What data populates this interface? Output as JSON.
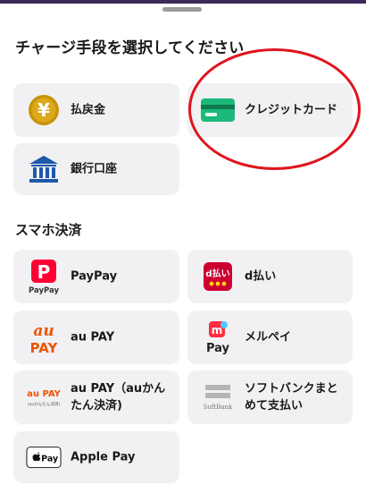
{
  "sheet": {
    "title": "チャージ手段を選択してください"
  },
  "main_methods": [
    {
      "label": "払戻金",
      "icon": "yen-coin-icon"
    },
    {
      "label": "クレジットカード",
      "icon": "credit-card-icon"
    },
    {
      "label": "銀行口座",
      "icon": "bank-icon"
    }
  ],
  "smartphone_section": {
    "title": "スマホ決済",
    "items": [
      {
        "label": "PayPay",
        "icon": "paypay-icon",
        "icon_text": "PayPay"
      },
      {
        "label": "d払い",
        "icon": "d-barai-icon",
        "icon_text": "d払い"
      },
      {
        "label": "au PAY",
        "icon": "au-pay-icon",
        "icon_text_top": "au",
        "icon_text_bottom": "PAY"
      },
      {
        "label": "メルペイ",
        "icon": "merpay-icon",
        "icon_text": "Pay"
      },
      {
        "label": "au PAY（auかんたん決済)",
        "icon": "au-pay-kantan-icon",
        "icon_text_top": "au PAY",
        "icon_text_bottom": "(auかんたん決済)"
      },
      {
        "label": "ソフトバンクまとめて支払い",
        "icon": "softbank-icon",
        "icon_text": "SoftBank"
      },
      {
        "label": "Apple Pay",
        "icon": "apple-pay-icon",
        "icon_text": "Pay"
      }
    ]
  },
  "annotation": {
    "color": "#e0141e"
  },
  "colors": {
    "card_background": "#f1f1f3",
    "paypay_red": "#ff0033",
    "au_orange": "#eb5505",
    "d_barai_red": "#cc0033",
    "card_green": "#1db97a",
    "bank_blue": "#1f58a9",
    "yen_gold": "#c8940a"
  }
}
